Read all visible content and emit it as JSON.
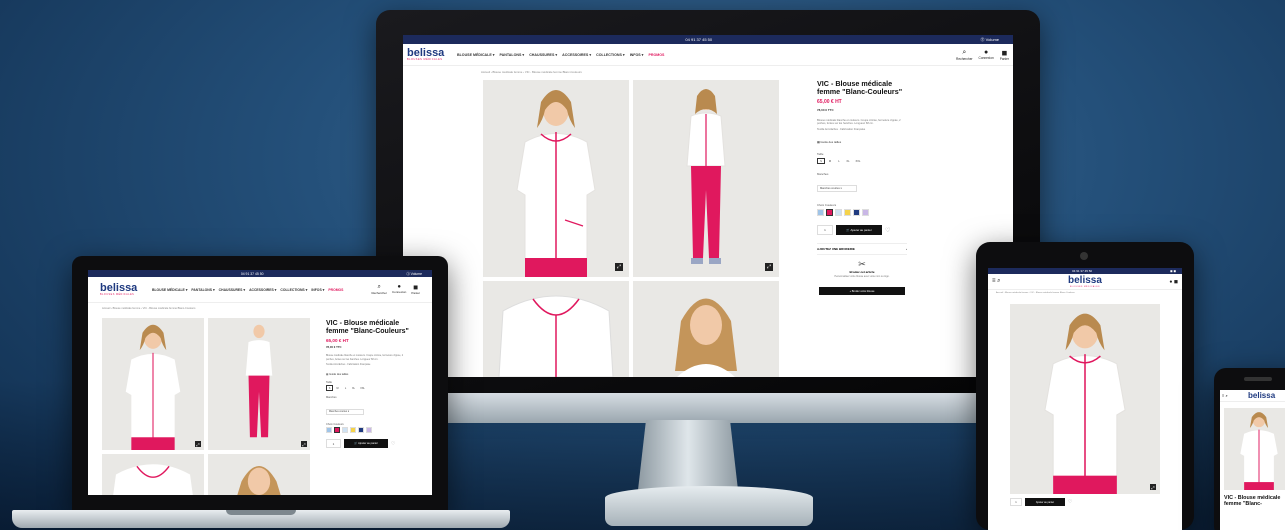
{
  "site": {
    "phone": "04 91 37 45 50",
    "topbar_right": "⓵ Volume",
    "logo": "belissa",
    "logo_tagline": "BLOUSES MÉDICALES",
    "nav": [
      "BLOUSE MÉDICALE ▾",
      "PANTALONS ▾",
      "CHAUSSURES ▾",
      "ACCESSOIRES ▾",
      "COLLECTIONS ▾",
      "INFOS ▾"
    ],
    "nav_promo": "PROMOS",
    "header_icons": {
      "search": "Rechercher",
      "account": "Connexion",
      "cart": "Panier"
    },
    "breadcrumb": "Accueil › Blouse médicale femme › VIC - Blouse médicale femme Blanc-Couleurs"
  },
  "product": {
    "title": "VIC - Blouse médicale femme \"Blanc-Couleurs\"",
    "title_short": "VIC - Blouse médicale femme \"Blanc-",
    "price_ht": "65,00 € HT",
    "price_ttc": "78,00 € TTC",
    "description": "Blouse médicale blanche et couleurs. Coupe cintrée, fermeture zippée, 2 poches, fentes sur les hanches. Longueur 68 cm.",
    "description2": "Textile Anti-tâches · Fabrication Française",
    "size_guide": "Guide des tailles",
    "size_label": "Taille",
    "sizes": [
      "S",
      "M",
      "L",
      "XL",
      "XXL"
    ],
    "sleeves_label": "Manches",
    "sleeves_value": "Manches courtes ▾",
    "color_label": "Choix Couleurs",
    "qty": "1",
    "add_to_cart": "Ajouter au panier",
    "wishlist_label": "AJOUTEZ UNE BRODERIE",
    "embroidery_title": "Brodez cet article",
    "embroidery_text": "Personnalisez votre blouse avec votre nom ou logo.",
    "embroidery_button": "+ Broder votre blouse"
  },
  "colors": {
    "brand_navy": "#1c2a5c",
    "brand_pink": "#e0185e",
    "swatches": [
      "#9fc4e8",
      "#e0185e",
      "#cfe2f3",
      "#f5d34a",
      "#1f3a80",
      "#c9b7e6"
    ]
  }
}
